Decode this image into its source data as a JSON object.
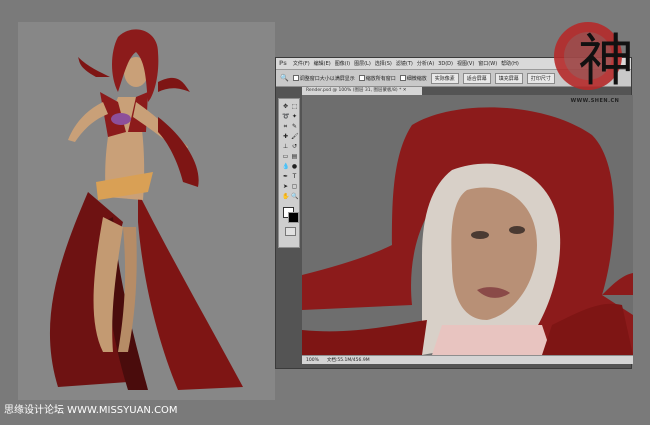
{
  "colors": {
    "background": "#7a7a7a",
    "robe_red": "#7e1514",
    "hair_red": "#8c1b1b",
    "skin": "#c9a078",
    "gold": "#d9a055",
    "ps_gray": "#545454"
  },
  "photoshop": {
    "logo": "Ps",
    "menu": [
      "文件(F)",
      "编辑(E)",
      "图像(I)",
      "图层(L)",
      "选择(S)",
      "滤镜(T)",
      "分析(A)",
      "3D(D)",
      "视图(V)",
      "窗口(W)",
      "帮助(H)"
    ],
    "options": {
      "check1": "调整窗口大小以满屏显示",
      "check2": "缩放所有窗口",
      "check3": "细微缩放",
      "btn_actual": "实际像素",
      "btn_fit": "适合屏幕",
      "btn_fill": "填充屏幕",
      "btn_print": "打印尺寸"
    },
    "doc_tab": "Render.psd @ 100% (图层 31, 图层蒙板/8) * ✕",
    "status": {
      "zoom": "100%",
      "doc": "文档:55.1M/456.9M"
    }
  },
  "branding": {
    "seal_char": "神",
    "seal_caption": "WWW.SHEN.CN"
  },
  "watermark": "思缘设计论坛 WWW.MISSYUAN.COM"
}
